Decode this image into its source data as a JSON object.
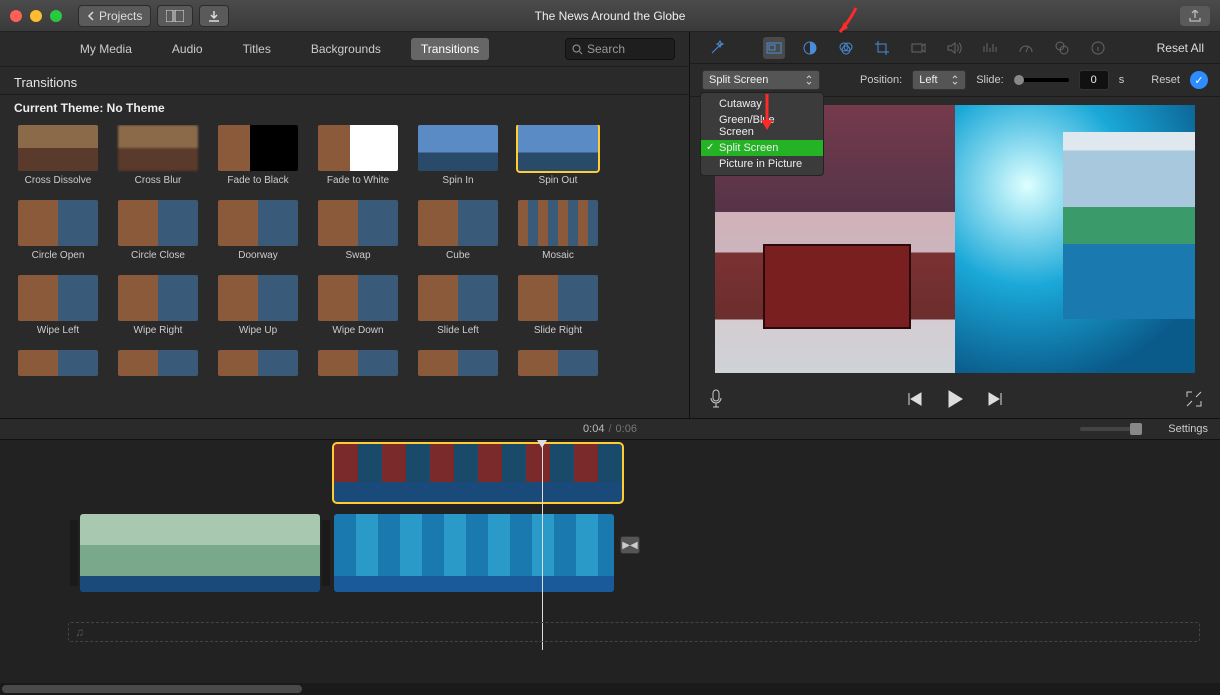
{
  "window": {
    "title": "The News Around the Globe",
    "projects_btn": "Projects"
  },
  "tabs": [
    "My Media",
    "Audio",
    "Titles",
    "Backgrounds",
    "Transitions"
  ],
  "tabs_active": "Transitions",
  "search_placeholder": "Search",
  "panel_title": "Transitions",
  "theme_label": "Current Theme: No Theme",
  "transitions": [
    "Cross Dissolve",
    "Cross Blur",
    "Fade to Black",
    "Fade to White",
    "Spin In",
    "Spin Out",
    "Circle Open",
    "Circle Close",
    "Doorway",
    "Swap",
    "Cube",
    "Mosaic",
    "Wipe Left",
    "Wipe Right",
    "Wipe Up",
    "Wipe Down",
    "Slide Left",
    "Slide Right",
    "",
    "",
    "",
    "",
    "",
    ""
  ],
  "transition_selected": "Spin Out",
  "toolbar": {
    "reset_all": "Reset All"
  },
  "overlay": {
    "mode": "Split Screen",
    "options": [
      "Cutaway",
      "Green/Blue Screen",
      "Split Screen",
      "Picture in Picture"
    ],
    "position_label": "Position:",
    "position_value": "Left",
    "slide_label": "Slide:",
    "seconds_value": "0",
    "seconds_unit": "s",
    "reset": "Reset"
  },
  "time_current": "0:04",
  "time_total": "0:06",
  "settings_label": "Settings"
}
